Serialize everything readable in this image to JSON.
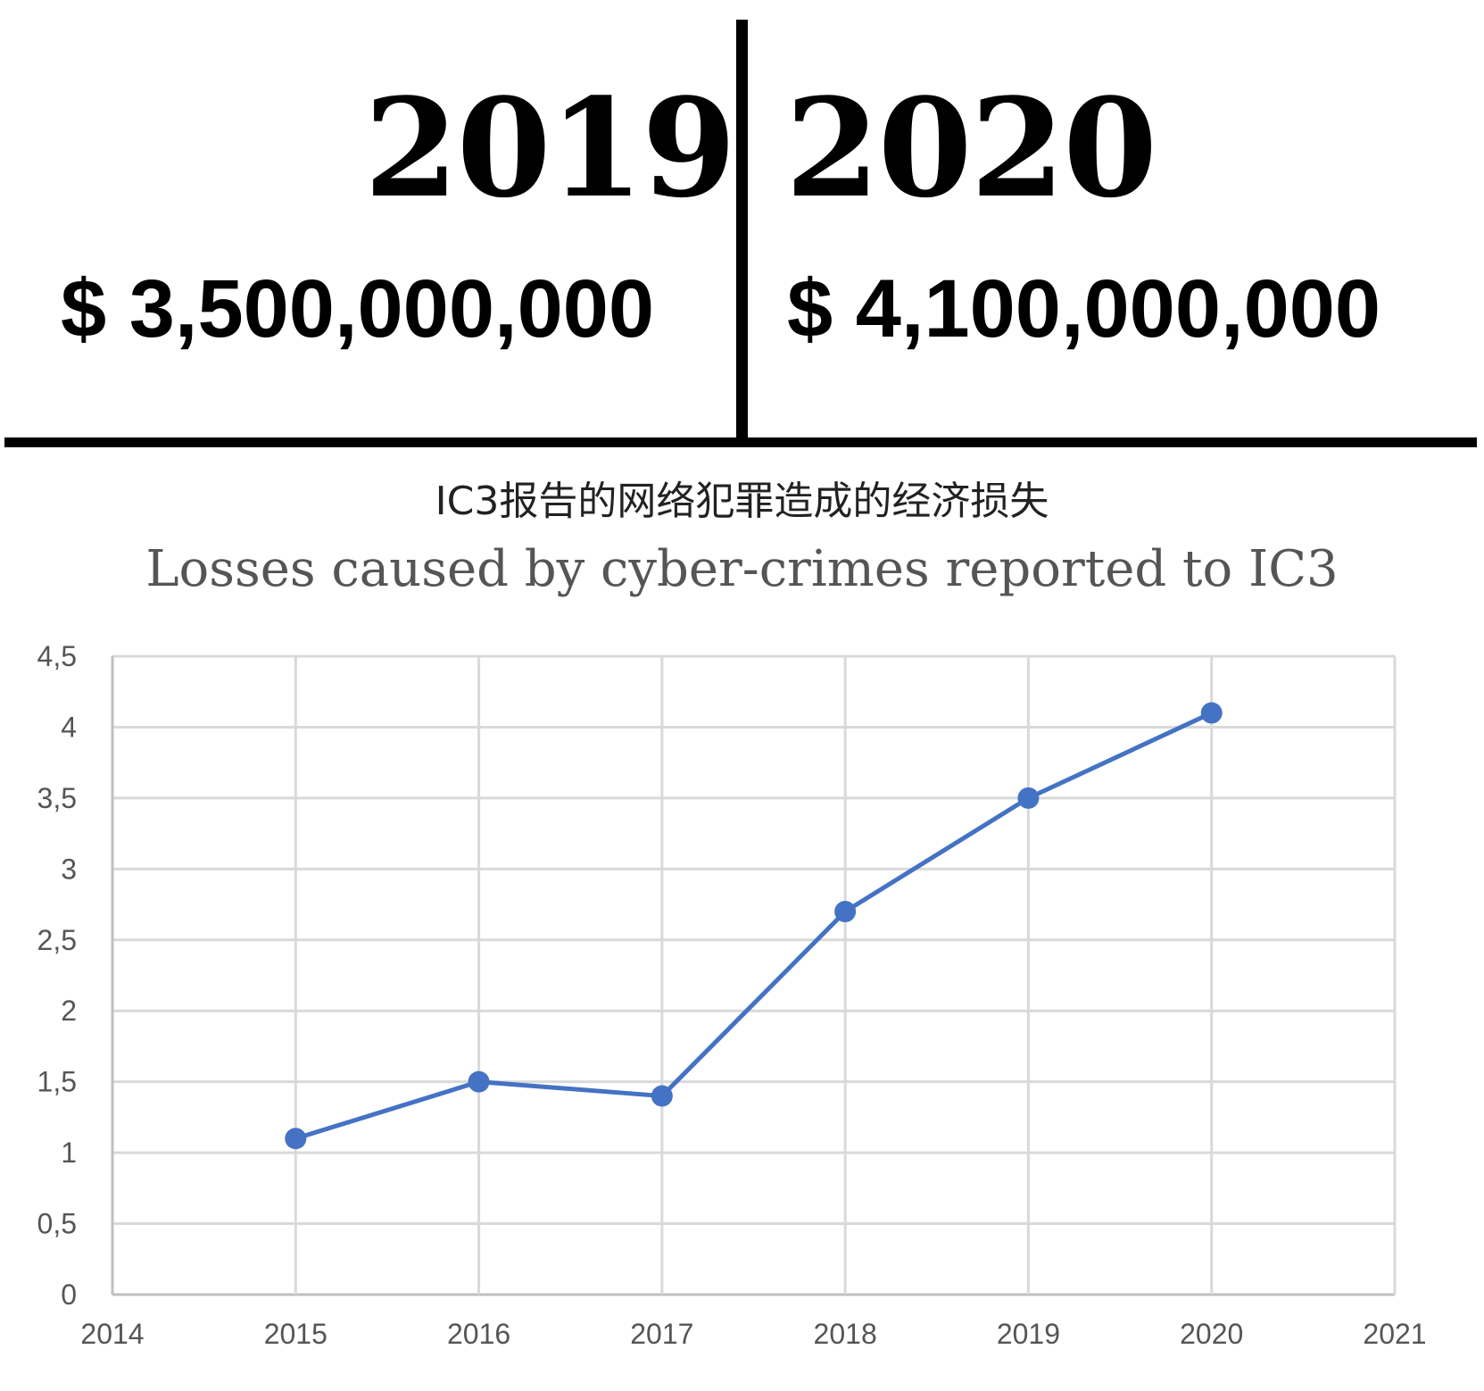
{
  "header": {
    "year_left": "2019",
    "year_right": "2020",
    "amount_left": "$ 3,500,000,000",
    "amount_right": "$ 4,100,000,000"
  },
  "chart_data": {
    "type": "line",
    "title": "IC3报告的网络犯罪造成的经济损失",
    "subtitle": "Losses caused by cyber-crimes reported to IC3",
    "xlabel": "",
    "ylabel": "",
    "x": [
      2015,
      2016,
      2017,
      2018,
      2019,
      2020
    ],
    "y": [
      1.1,
      1.5,
      1.4,
      2.7,
      3.5,
      4.1
    ],
    "xlim": [
      2014,
      2021
    ],
    "ylim": [
      0,
      4.5
    ],
    "x_ticks": [
      "2014",
      "2015",
      "2016",
      "2017",
      "2018",
      "2019",
      "2020",
      "2021"
    ],
    "y_ticks": [
      "0",
      "0,5",
      "1",
      "1,5",
      "2",
      "2,5",
      "3",
      "3,5",
      "4",
      "4,5"
    ],
    "grid": true,
    "legend": "none",
    "line_color": "#4472C4",
    "grid_color": "#d9d9d9"
  }
}
